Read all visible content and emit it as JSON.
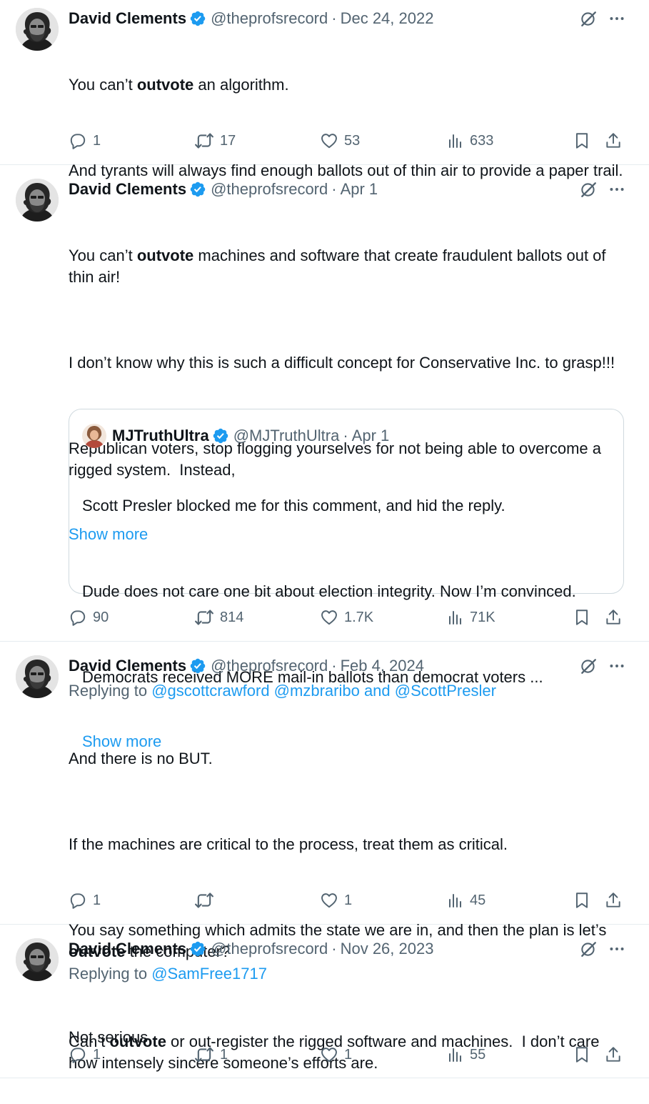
{
  "colors": {
    "accent": "#1d9bf0",
    "text": "#0f1419",
    "muted": "#536471",
    "border": "#cfd9de"
  },
  "tweets": [
    {
      "author": "David Clements",
      "handle": "@theprofsrecord",
      "sep": "·",
      "date": "Dec 24, 2022",
      "body": [
        {
          "pre": "You can’t ",
          "bold": "outvote",
          "post": " an algorithm."
        },
        {
          "pre": "",
          "bold": "",
          "post": "And tyrants will always find enough ballots out of thin air to provide a paper trail."
        }
      ],
      "stats": {
        "replies": "1",
        "retweets": "17",
        "likes": "53",
        "views": "633"
      }
    },
    {
      "author": "David Clements",
      "handle": "@theprofsrecord",
      "sep": "·",
      "date": "Apr 1",
      "body": [
        {
          "pre": "You can’t ",
          "bold": "outvote",
          "post": " machines and software that create fraudulent ballots out of thin air!"
        },
        {
          "pre": "",
          "bold": "",
          "post": "I don’t know why this is such a difficult concept for Conservative Inc. to grasp!!!"
        },
        {
          "pre": "",
          "bold": "",
          "post": "Republican voters, stop flogging yourselves for not being able to overcome a rigged system.  Instead,"
        }
      ],
      "show_more": "Show more",
      "quote": {
        "author": "MJTruthUltra",
        "handle": "@MJTruthUltra",
        "sep": "·",
        "date": "Apr 1",
        "body": [
          "Scott Presler blocked me for this comment, and hid the reply.",
          "Dude does not care one bit about election integrity. Now I’m convinced.",
          "Democrats received MORE mail-in ballots than democrat voters ..."
        ],
        "show_more": "Show more"
      },
      "stats": {
        "replies": "90",
        "retweets": "814",
        "likes": "1.7K",
        "views": "71K"
      }
    },
    {
      "author": "David Clements",
      "handle": "@theprofsrecord",
      "sep": "·",
      "date": "Feb 4, 2024",
      "replying_prefix": "Replying to ",
      "replying_mentions": "@gscottcrawford @mzbraribo and @ScottPresler",
      "body": [
        {
          "pre": "",
          "bold": "",
          "post": "And there is no BUT."
        },
        {
          "pre": "",
          "bold": "",
          "post": "If the machines are critical to the process, treat them as critical."
        },
        {
          "pre": "You say something which admits the state we are in, and then the plan is let’s ",
          "bold": "outvote",
          "post": " the computer?"
        },
        {
          "pre": "",
          "bold": "",
          "post": "Not serious."
        }
      ],
      "stats": {
        "replies": "1",
        "retweets": "",
        "likes": "1",
        "views": "45"
      }
    },
    {
      "author": "David Clements",
      "handle": "@theprofsrecord",
      "sep": "·",
      "date": "Nov 26, 2023",
      "replying_prefix": "Replying to ",
      "replying_mentions": "@SamFree1717",
      "body": [
        {
          "pre": "Can’t ",
          "bold": "outvote",
          "post": " or out-register the rigged software and machines.  I don’t care how intensely sincere someone’s efforts are."
        }
      ],
      "stats": {
        "replies": "1",
        "retweets": "1",
        "likes": "1",
        "views": "55"
      }
    }
  ]
}
